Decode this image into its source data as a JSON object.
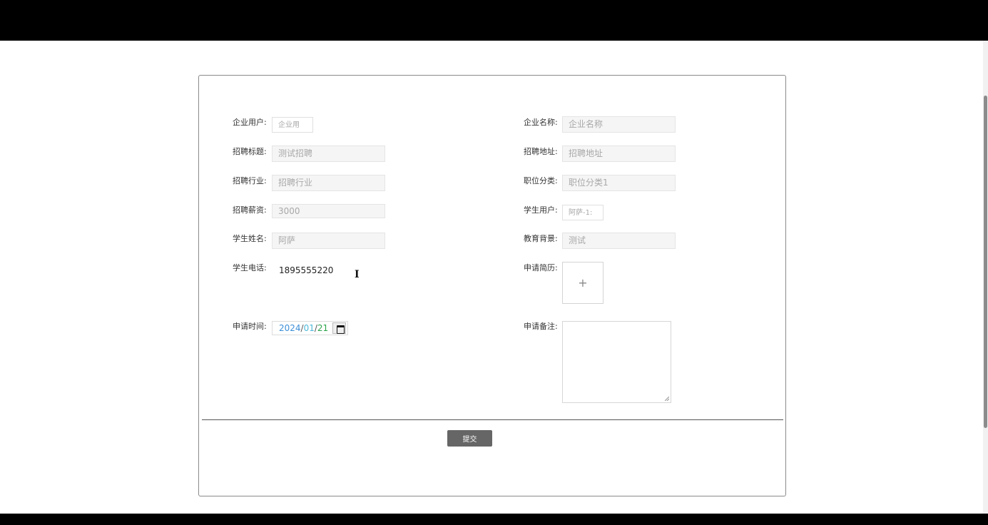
{
  "form": {
    "fields": {
      "company_user": {
        "label": "企业用户:",
        "value": "企业用"
      },
      "company_name": {
        "label": "企业名称:",
        "value": "企业名称"
      },
      "job_title": {
        "label": "招聘标题:",
        "value": "测试招聘"
      },
      "job_address": {
        "label": "招聘地址:",
        "value": "招聘地址"
      },
      "industry": {
        "label": "招聘行业:",
        "value": "招聘行业"
      },
      "job_category": {
        "label": "职位分类:",
        "value": "职位分类1"
      },
      "salary": {
        "label": "招聘薪资:",
        "value": "3000"
      },
      "student_user": {
        "label": "学生用户:",
        "value": "阿萨-1:"
      },
      "student_name": {
        "label": "学生姓名:",
        "value": "阿萨"
      },
      "education": {
        "label": "教育背景:",
        "value": "测试"
      },
      "student_phone": {
        "label": "学生电话:",
        "value": "1895555220"
      },
      "resume": {
        "label": "申请简历:",
        "upload_glyph": "+"
      },
      "apply_date": {
        "label": "申请时间:",
        "year": "2024",
        "month": "01",
        "day": "21",
        "sep": "/"
      },
      "remarks": {
        "label": "申请备注:"
      }
    },
    "submit_label": "提交"
  },
  "icons": {
    "text_cursor": "text-cursor-icon",
    "calendar": "calendar-icon",
    "upload": "plus-icon"
  },
  "colors": {
    "button_bg": "#666666",
    "date_year": "#3d8fd8",
    "date_month": "#4db8d8",
    "date_day": "#2aa34a"
  }
}
